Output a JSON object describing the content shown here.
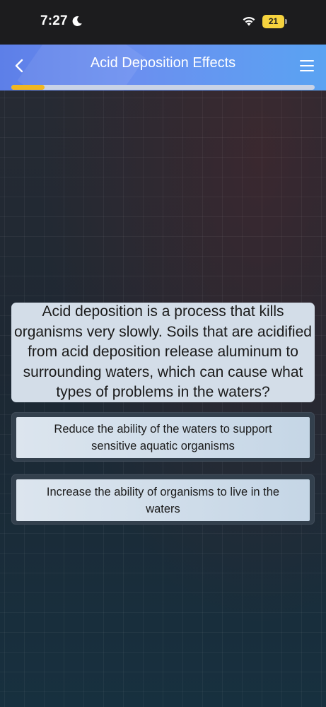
{
  "status_bar": {
    "time": "7:27",
    "battery_level": "21",
    "icons": [
      "moon-icon",
      "wifi-icon",
      "battery-icon"
    ]
  },
  "header": {
    "title": "Acid Deposition Effects",
    "back_icon": "chevron-left-icon",
    "menu_icon": "hamburger-menu-icon",
    "progress": 0.11
  },
  "question": {
    "text": "Acid deposition is a process that kills organisms very slowly. Soils that are acidified from acid deposition release aluminum to surrounding waters, which can cause what types of problems in the waters?"
  },
  "answers": [
    {
      "label": "Reduce the ability of the waters to support sensitive aquatic organisms"
    },
    {
      "label": "Increase the ability of organisms to live in the waters"
    }
  ],
  "colors": {
    "header_gradient_start": "#5d7fe8",
    "header_gradient_end": "#5aa3f2",
    "progress_fill": "#f2b720",
    "battery": "#f6d33e",
    "card_bg": "#d3dde8"
  }
}
